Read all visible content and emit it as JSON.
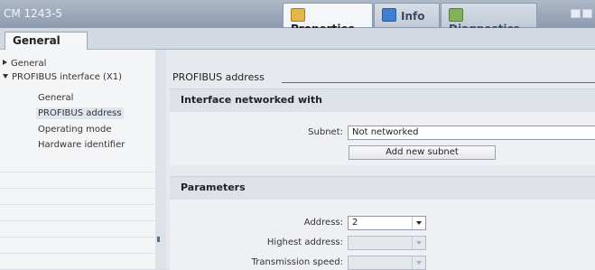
{
  "window": {
    "title": "CM 1243-5",
    "tabs": [
      {
        "label": "Properties",
        "icon": "properties-icon",
        "active": true
      },
      {
        "label": "Info",
        "icon": "info-icon",
        "active": false
      },
      {
        "label": "Diagnostics",
        "icon": "diagnostics-icon",
        "active": false
      }
    ]
  },
  "subtabs": {
    "general": "General"
  },
  "nav": {
    "items": [
      {
        "label": "General",
        "expander": "collapsed"
      },
      {
        "label": "PROFIBUS interface (X1)",
        "expander": "expanded"
      },
      {
        "label": "General"
      },
      {
        "label": "PROFIBUS address",
        "selected": true
      },
      {
        "label": "Operating mode"
      },
      {
        "label": "Hardware identifier"
      }
    ]
  },
  "content": {
    "section_title": "PROFIBUS address",
    "interface": {
      "heading": "Interface networked with",
      "subnet_label": "Subnet:",
      "subnet_value": "Not networked",
      "add_subnet_button": "Add new subnet"
    },
    "parameters": {
      "heading": "Parameters",
      "address_label": "Address:",
      "address_value": "2",
      "highest_address_label": "Highest address:",
      "highest_address_value": "",
      "transmission_speed_label": "Transmission speed:",
      "transmission_speed_value": ""
    }
  },
  "colors": {
    "titlebar": "#9aa6b8",
    "panel": "#eef0f3"
  }
}
